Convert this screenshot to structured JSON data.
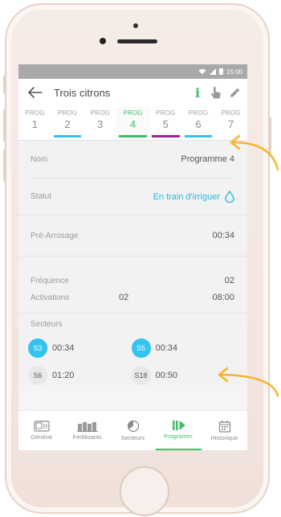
{
  "status_bar": {
    "time": "15:00"
  },
  "app_bar": {
    "title": "Trois citrons",
    "info_label": "i"
  },
  "prog_tabs": [
    {
      "top": "PROG",
      "num": "1",
      "bar_color": ""
    },
    {
      "top": "PROG",
      "num": "2",
      "bar_color": "#33c3ef"
    },
    {
      "top": "PROG",
      "num": "3",
      "bar_color": ""
    },
    {
      "top": "PROG",
      "num": "4",
      "bar_color": "#3fc06a"
    },
    {
      "top": "PROG",
      "num": "5",
      "bar_color": "#a020a0"
    },
    {
      "top": "PROG",
      "num": "6",
      "bar_color": "#33c3ef"
    },
    {
      "top": "PROG",
      "num": "7",
      "bar_color": ""
    }
  ],
  "details": {
    "nom_label": "Nom",
    "nom_value": "Programme 4",
    "statut_label": "Statut",
    "statut_value": "En train d'irriguer",
    "pre_label": "Pré-Arrosage",
    "pre_value": "00:34",
    "freq_label": "Fréquence",
    "freq_value": "02",
    "act_label": "Activations",
    "act_count": "02",
    "act_time": "08:00"
  },
  "secteurs": {
    "title": "Secteurs",
    "items": [
      {
        "code": "S3",
        "time": "00:34",
        "active": true
      },
      {
        "code": "S5",
        "time": "00:34",
        "active": true
      },
      {
        "code": "S6",
        "time": "01:20",
        "active": false
      },
      {
        "code": "S18",
        "time": "00:50",
        "active": false
      }
    ]
  },
  "bottom_nav": [
    {
      "label": "Général",
      "icon": "general-icon"
    },
    {
      "label": "Fertilisants",
      "icon": "fertilisants-icon"
    },
    {
      "label": "Secteurs",
      "icon": "secteurs-icon"
    },
    {
      "label": "Programm.",
      "icon": "play-icon",
      "active": true
    },
    {
      "label": "Historique",
      "icon": "calendar-icon"
    }
  ],
  "colors": {
    "accent_green": "#3fc06a",
    "accent_blue": "#33c3ef",
    "annotation_arrow": "#f5b52e"
  }
}
